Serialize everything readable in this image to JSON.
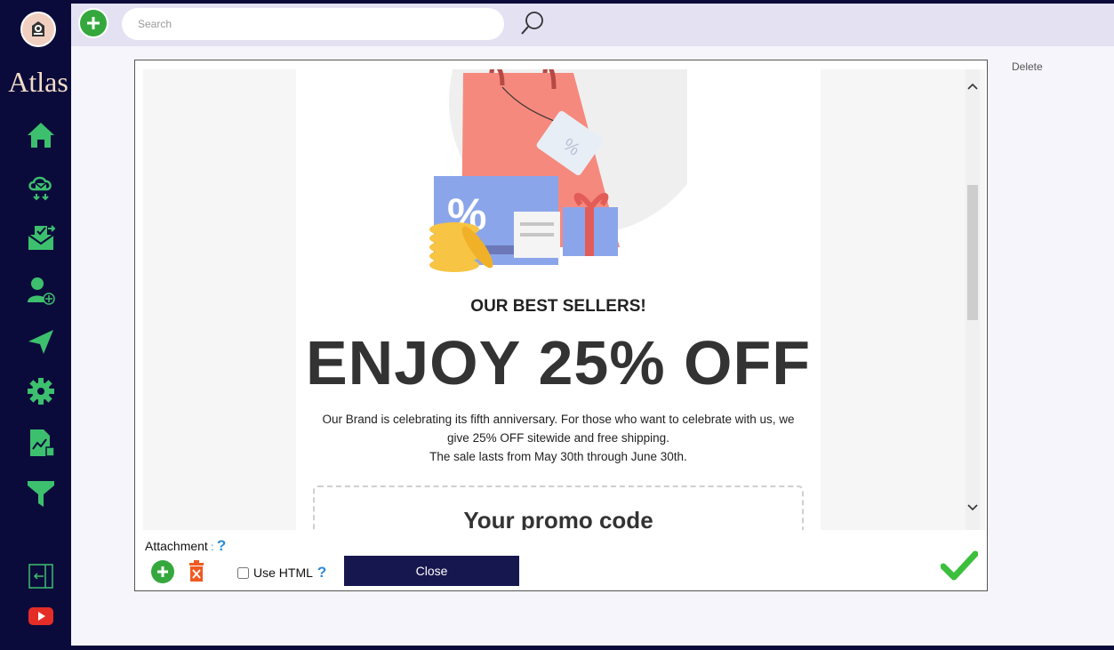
{
  "app": {
    "logo_text": "Atlas"
  },
  "sidebar": {
    "items": [
      {
        "icon": "home-icon"
      },
      {
        "icon": "email-cloud-icon"
      },
      {
        "icon": "inbox-icon"
      },
      {
        "icon": "add-user-icon"
      },
      {
        "icon": "send-icon"
      },
      {
        "icon": "gear-icon"
      },
      {
        "icon": "report-icon"
      },
      {
        "icon": "filter-icon"
      }
    ],
    "bottom": [
      {
        "icon": "logout-icon"
      },
      {
        "icon": "youtube-icon"
      }
    ]
  },
  "topbar": {
    "search_placeholder": "Search"
  },
  "actions": {
    "delete_label": "Delete"
  },
  "email": {
    "heading": "OUR BEST SELLERS!",
    "headline": "ENJOY 25% OFF",
    "body_line1": "Our Brand is celebrating its fifth anniversary. For those who want to celebrate with us, we",
    "body_line2": "give 25% OFF sitewide and free shipping.",
    "body_line3": "The sale lasts from May 30th through June 30th.",
    "promo_title": "Your promo code"
  },
  "dialog": {
    "attachment_label": "Attachment",
    "attachment_sep": " : ",
    "help_glyph": "?",
    "use_html_label": "Use HTML",
    "use_html_checked": false,
    "close_label": "Close"
  },
  "colors": {
    "sidebar_bg": "#0b0b3b",
    "icon_green": "#3cc06e",
    "accent_green": "#35a83d",
    "close_button_bg": "#17174f",
    "topbar_bg": "#e4e1f3",
    "help_blue": "#2b8ad8"
  }
}
